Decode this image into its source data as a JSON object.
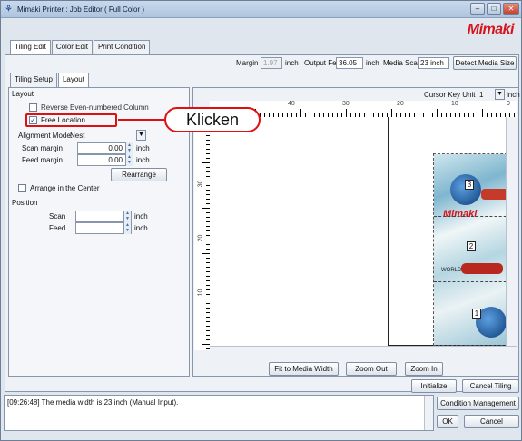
{
  "window": {
    "title": "Mimaki Printer : Job Editor ( Full Color )",
    "brand": "Mimaki",
    "controls": [
      "–",
      "□",
      "✕"
    ]
  },
  "main_tabs": [
    "Tiling Edit",
    "Color Edit",
    "Print Condition"
  ],
  "top_bar": {
    "margin_label": "Margin",
    "margin_value": "1.97",
    "margin_unit": "inch",
    "output_feed_label": "Output Feed",
    "output_feed_value": "36.05",
    "output_feed_unit": "inch",
    "media_scan_label": "Media Scan",
    "media_scan_value": "23 inch",
    "detect_button": "Detect Media Size"
  },
  "sub_tabs": [
    "Tiling Setup",
    "Layout"
  ],
  "layout": {
    "section": "Layout",
    "reverse_even": "Reverse Even-numbered Column",
    "free_location": "Free Location",
    "free_location_checked": true,
    "alignment_mode": "Alignment Mode:",
    "alignment_value": "Nest",
    "scan_margin_label": "Scan margin",
    "scan_margin_value": "0.00",
    "feed_margin_label": "Feed margin",
    "feed_margin_value": "0.00",
    "unit": "inch",
    "rearrange": "Rearrange",
    "arrange_center": "Arrange in the Center"
  },
  "position": {
    "section": "Position",
    "scan_label": "Scan",
    "feed_label": "Feed",
    "unit": "inch"
  },
  "callout": "Klicken",
  "canvas": {
    "cursor_key_label": "Cursor Key Unit",
    "cursor_key_value": "1",
    "cursor_key_unit": "inch",
    "ruler_h": [
      "40",
      "30",
      "20",
      "10",
      "0"
    ],
    "ruler_v": [
      "30",
      "20",
      "10"
    ],
    "tile_numbers": [
      "3",
      "2",
      "1"
    ],
    "poster_brand": "Mimaki",
    "poster_text": "WORLD"
  },
  "canvas_buttons": [
    "Fit to Media Width",
    "Zoom Out",
    "Zoom In"
  ],
  "bottom_buttons": [
    "Initialize",
    "Cancel Tiling"
  ],
  "status": {
    "message": "[09:26:48] The media width is 23 inch (Manual Input)."
  },
  "right_buttons": [
    "Condition Management",
    "OK",
    "Cancel"
  ]
}
